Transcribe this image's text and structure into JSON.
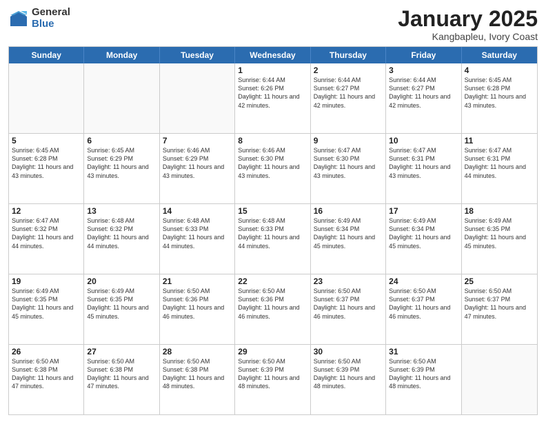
{
  "logo": {
    "general": "General",
    "blue": "Blue"
  },
  "header": {
    "month": "January 2025",
    "location": "Kangbapleu, Ivory Coast"
  },
  "weekdays": [
    "Sunday",
    "Monday",
    "Tuesday",
    "Wednesday",
    "Thursday",
    "Friday",
    "Saturday"
  ],
  "rows": [
    [
      {
        "day": "",
        "sunrise": "",
        "sunset": "",
        "daylight": ""
      },
      {
        "day": "",
        "sunrise": "",
        "sunset": "",
        "daylight": ""
      },
      {
        "day": "",
        "sunrise": "",
        "sunset": "",
        "daylight": ""
      },
      {
        "day": "1",
        "sunrise": "Sunrise: 6:44 AM",
        "sunset": "Sunset: 6:26 PM",
        "daylight": "Daylight: 11 hours and 42 minutes."
      },
      {
        "day": "2",
        "sunrise": "Sunrise: 6:44 AM",
        "sunset": "Sunset: 6:27 PM",
        "daylight": "Daylight: 11 hours and 42 minutes."
      },
      {
        "day": "3",
        "sunrise": "Sunrise: 6:44 AM",
        "sunset": "Sunset: 6:27 PM",
        "daylight": "Daylight: 11 hours and 42 minutes."
      },
      {
        "day": "4",
        "sunrise": "Sunrise: 6:45 AM",
        "sunset": "Sunset: 6:28 PM",
        "daylight": "Daylight: 11 hours and 43 minutes."
      }
    ],
    [
      {
        "day": "5",
        "sunrise": "Sunrise: 6:45 AM",
        "sunset": "Sunset: 6:28 PM",
        "daylight": "Daylight: 11 hours and 43 minutes."
      },
      {
        "day": "6",
        "sunrise": "Sunrise: 6:45 AM",
        "sunset": "Sunset: 6:29 PM",
        "daylight": "Daylight: 11 hours and 43 minutes."
      },
      {
        "day": "7",
        "sunrise": "Sunrise: 6:46 AM",
        "sunset": "Sunset: 6:29 PM",
        "daylight": "Daylight: 11 hours and 43 minutes."
      },
      {
        "day": "8",
        "sunrise": "Sunrise: 6:46 AM",
        "sunset": "Sunset: 6:30 PM",
        "daylight": "Daylight: 11 hours and 43 minutes."
      },
      {
        "day": "9",
        "sunrise": "Sunrise: 6:47 AM",
        "sunset": "Sunset: 6:30 PM",
        "daylight": "Daylight: 11 hours and 43 minutes."
      },
      {
        "day": "10",
        "sunrise": "Sunrise: 6:47 AM",
        "sunset": "Sunset: 6:31 PM",
        "daylight": "Daylight: 11 hours and 43 minutes."
      },
      {
        "day": "11",
        "sunrise": "Sunrise: 6:47 AM",
        "sunset": "Sunset: 6:31 PM",
        "daylight": "Daylight: 11 hours and 44 minutes."
      }
    ],
    [
      {
        "day": "12",
        "sunrise": "Sunrise: 6:47 AM",
        "sunset": "Sunset: 6:32 PM",
        "daylight": "Daylight: 11 hours and 44 minutes."
      },
      {
        "day": "13",
        "sunrise": "Sunrise: 6:48 AM",
        "sunset": "Sunset: 6:32 PM",
        "daylight": "Daylight: 11 hours and 44 minutes."
      },
      {
        "day": "14",
        "sunrise": "Sunrise: 6:48 AM",
        "sunset": "Sunset: 6:33 PM",
        "daylight": "Daylight: 11 hours and 44 minutes."
      },
      {
        "day": "15",
        "sunrise": "Sunrise: 6:48 AM",
        "sunset": "Sunset: 6:33 PM",
        "daylight": "Daylight: 11 hours and 44 minutes."
      },
      {
        "day": "16",
        "sunrise": "Sunrise: 6:49 AM",
        "sunset": "Sunset: 6:34 PM",
        "daylight": "Daylight: 11 hours and 45 minutes."
      },
      {
        "day": "17",
        "sunrise": "Sunrise: 6:49 AM",
        "sunset": "Sunset: 6:34 PM",
        "daylight": "Daylight: 11 hours and 45 minutes."
      },
      {
        "day": "18",
        "sunrise": "Sunrise: 6:49 AM",
        "sunset": "Sunset: 6:35 PM",
        "daylight": "Daylight: 11 hours and 45 minutes."
      }
    ],
    [
      {
        "day": "19",
        "sunrise": "Sunrise: 6:49 AM",
        "sunset": "Sunset: 6:35 PM",
        "daylight": "Daylight: 11 hours and 45 minutes."
      },
      {
        "day": "20",
        "sunrise": "Sunrise: 6:49 AM",
        "sunset": "Sunset: 6:35 PM",
        "daylight": "Daylight: 11 hours and 45 minutes."
      },
      {
        "day": "21",
        "sunrise": "Sunrise: 6:50 AM",
        "sunset": "Sunset: 6:36 PM",
        "daylight": "Daylight: 11 hours and 46 minutes."
      },
      {
        "day": "22",
        "sunrise": "Sunrise: 6:50 AM",
        "sunset": "Sunset: 6:36 PM",
        "daylight": "Daylight: 11 hours and 46 minutes."
      },
      {
        "day": "23",
        "sunrise": "Sunrise: 6:50 AM",
        "sunset": "Sunset: 6:37 PM",
        "daylight": "Daylight: 11 hours and 46 minutes."
      },
      {
        "day": "24",
        "sunrise": "Sunrise: 6:50 AM",
        "sunset": "Sunset: 6:37 PM",
        "daylight": "Daylight: 11 hours and 46 minutes."
      },
      {
        "day": "25",
        "sunrise": "Sunrise: 6:50 AM",
        "sunset": "Sunset: 6:37 PM",
        "daylight": "Daylight: 11 hours and 47 minutes."
      }
    ],
    [
      {
        "day": "26",
        "sunrise": "Sunrise: 6:50 AM",
        "sunset": "Sunset: 6:38 PM",
        "daylight": "Daylight: 11 hours and 47 minutes."
      },
      {
        "day": "27",
        "sunrise": "Sunrise: 6:50 AM",
        "sunset": "Sunset: 6:38 PM",
        "daylight": "Daylight: 11 hours and 47 minutes."
      },
      {
        "day": "28",
        "sunrise": "Sunrise: 6:50 AM",
        "sunset": "Sunset: 6:38 PM",
        "daylight": "Daylight: 11 hours and 48 minutes."
      },
      {
        "day": "29",
        "sunrise": "Sunrise: 6:50 AM",
        "sunset": "Sunset: 6:39 PM",
        "daylight": "Daylight: 11 hours and 48 minutes."
      },
      {
        "day": "30",
        "sunrise": "Sunrise: 6:50 AM",
        "sunset": "Sunset: 6:39 PM",
        "daylight": "Daylight: 11 hours and 48 minutes."
      },
      {
        "day": "31",
        "sunrise": "Sunrise: 6:50 AM",
        "sunset": "Sunset: 6:39 PM",
        "daylight": "Daylight: 11 hours and 48 minutes."
      },
      {
        "day": "",
        "sunrise": "",
        "sunset": "",
        "daylight": ""
      }
    ]
  ]
}
